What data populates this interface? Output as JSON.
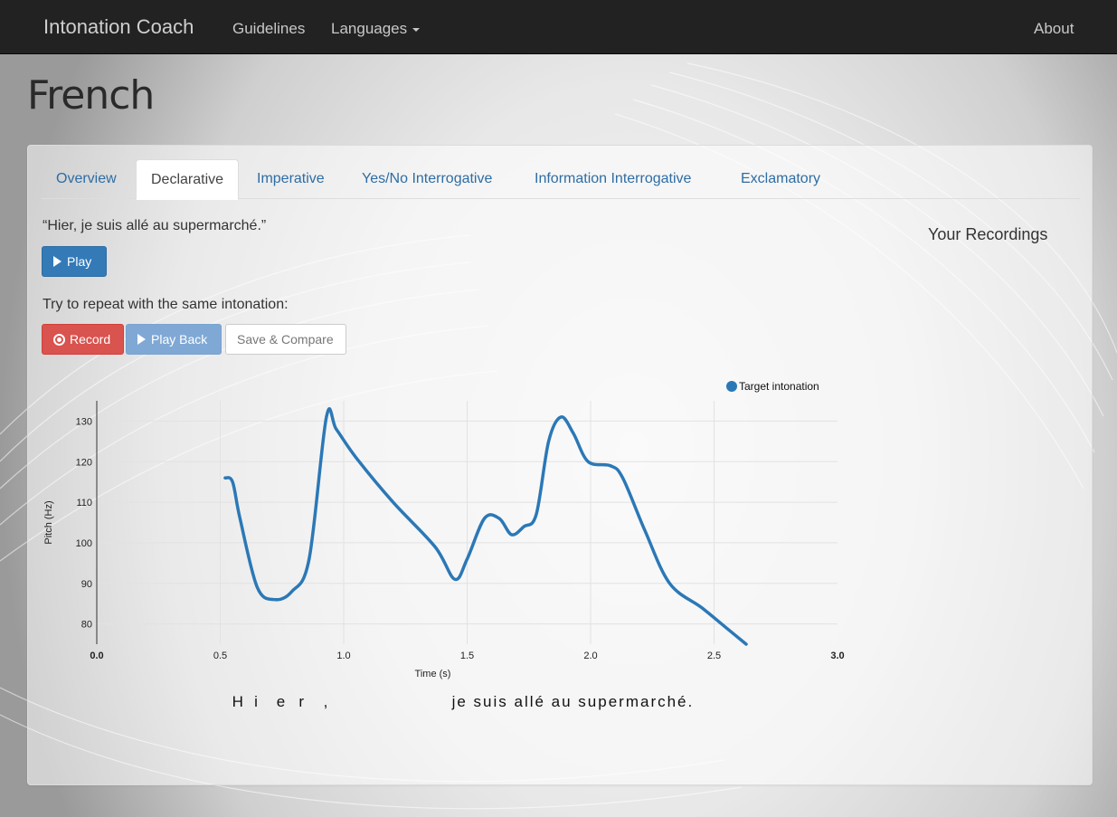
{
  "navbar": {
    "brand": "Intonation Coach",
    "guidelines": "Guidelines",
    "languages": "Languages",
    "about": "About"
  },
  "page": {
    "title": "French"
  },
  "tabs": [
    {
      "label": "Overview",
      "active": false
    },
    {
      "label": "Declarative",
      "active": true
    },
    {
      "label": "Imperative",
      "active": false
    },
    {
      "label": "Yes/No Interrogative",
      "active": false
    },
    {
      "label": "Information Interrogative",
      "active": false
    },
    {
      "label": "Exclamatory",
      "active": false
    }
  ],
  "lesson": {
    "quote": "“Hier, je suis allé au supermarché.”",
    "play_label": "Play",
    "repeat_label": "Try to repeat with the same intonation:",
    "record_label": "Record",
    "playback_label": "Play Back",
    "save_label": "Save & Compare"
  },
  "recordings": {
    "title": "Your Recordings"
  },
  "colors": {
    "accent": "#337ab7",
    "record": "#d9534f",
    "playback": "#7fa8d5",
    "series": "#2b78b6"
  },
  "chart_data": {
    "type": "line",
    "xlabel": "Time (s)",
    "ylabel": "Pitch (Hz)",
    "xlim": [
      0.0,
      3.0
    ],
    "ylim": [
      75,
      135
    ],
    "xticks": [
      "0.0",
      "0.5",
      "1.0",
      "1.5",
      "2.0",
      "2.5",
      "3.0"
    ],
    "yticks": [
      "80",
      "90",
      "100",
      "110",
      "120",
      "130"
    ],
    "grid": true,
    "legend": "top-right",
    "series": [
      {
        "name": "Target intonation",
        "color": "#2b78b6",
        "x": [
          0.52,
          0.55,
          0.58,
          0.65,
          0.72,
          0.79,
          0.86,
          0.93,
          0.97,
          1.05,
          1.2,
          1.37,
          1.45,
          1.5,
          1.57,
          1.63,
          1.68,
          1.73,
          1.78,
          1.83,
          1.88,
          1.93,
          1.99,
          2.08,
          2.13,
          2.22,
          2.32,
          2.45,
          2.55,
          2.63
        ],
        "y": [
          116,
          115,
          106,
          89,
          86,
          88,
          96,
          131,
          128,
          121,
          110,
          99,
          91,
          96,
          106,
          106,
          102,
          104,
          107,
          125,
          131,
          127,
          120,
          119,
          116,
          103,
          90,
          84,
          79,
          75
        ]
      }
    ],
    "annotations": {
      "syllables": [
        {
          "text": "H",
          "t": 0.57
        },
        {
          "text": "i",
          "t": 0.66
        },
        {
          "text": "e",
          "t": 0.75
        },
        {
          "text": "r",
          "t": 0.84
        },
        {
          "text": ",",
          "t": 0.94
        },
        {
          "text": "je suis allé au supermarché.",
          "t": 1.46
        }
      ]
    }
  }
}
